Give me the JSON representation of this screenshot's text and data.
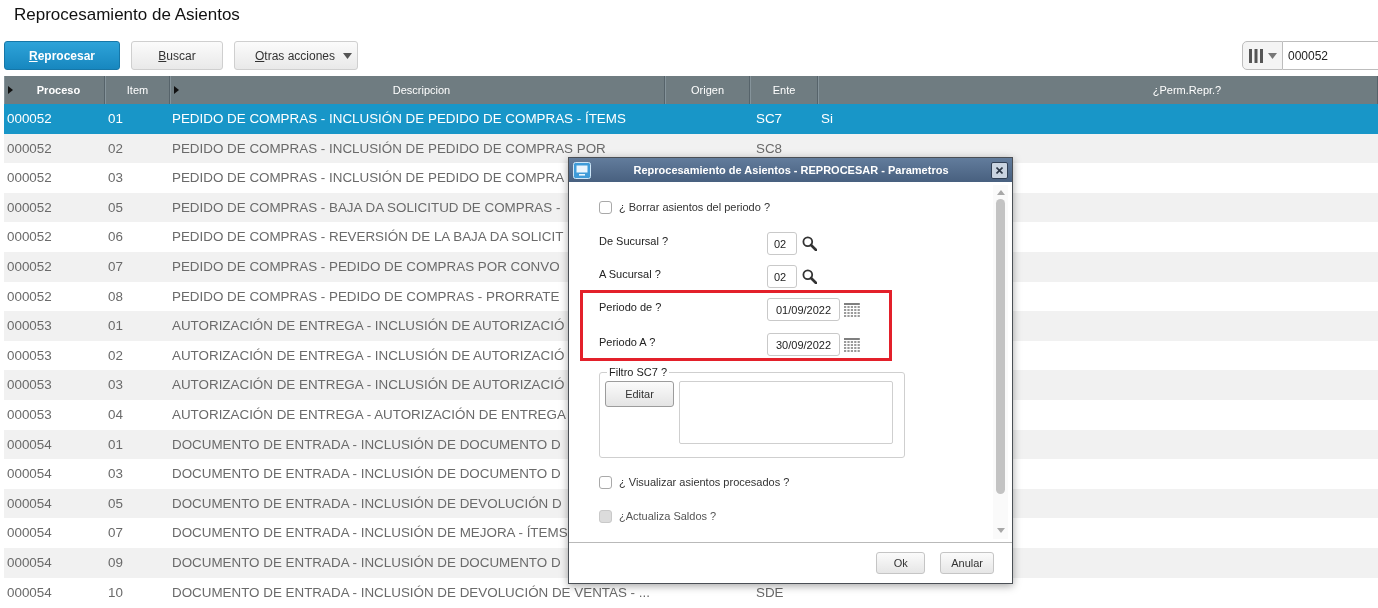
{
  "page": {
    "title": "Reprocesamiento de Asientos"
  },
  "toolbar": {
    "buttons": [
      {
        "label": "Reprocesar",
        "kind": "primary"
      },
      {
        "label": "Buscar",
        "kind": "plain"
      },
      {
        "label": "Otras acciones",
        "kind": "menu"
      }
    ],
    "search": {
      "value": "000052"
    }
  },
  "table": {
    "columns": [
      {
        "label": "Proceso",
        "expander": true,
        "bold": true
      },
      {
        "label": "Item",
        "expander": false,
        "bold": false
      },
      {
        "label": "Descripcion",
        "expander": true,
        "bold": false
      },
      {
        "label": "Origen",
        "expander": false,
        "bold": false
      },
      {
        "label": "Ente",
        "expander": false,
        "bold": false
      },
      {
        "label": "¿Perm.Repr.?",
        "expander": false,
        "bold": false
      }
    ],
    "rows": [
      {
        "proceso": "000052",
        "item": "01",
        "descripcion": "PEDIDO DE COMPRAS - INCLUSIÓN DE PEDIDO DE COMPRAS - ÍTEMS",
        "ente": "SC7",
        "perm_repr": "Si",
        "selected": true
      },
      {
        "proceso": "000052",
        "item": "02",
        "descripcion": "PEDIDO DE COMPRAS - INCLUSIÓN DE PEDIDO DE COMPRAS POR",
        "ente": "SC8",
        "selected": false
      },
      {
        "proceso": "000052",
        "item": "03",
        "descripcion": "PEDIDO DE COMPRAS - INCLUSIÓN DE PEDIDO DE COMPRA",
        "selected": false
      },
      {
        "proceso": "000052",
        "item": "05",
        "descripcion": "PEDIDO DE COMPRAS - BAJA DA SOLICITUD DE COMPRAS -",
        "selected": false
      },
      {
        "proceso": "000052",
        "item": "06",
        "descripcion": "PEDIDO DE COMPRAS - REVERSIÓN DE LA BAJA DA SOLICIT",
        "selected": false
      },
      {
        "proceso": "000052",
        "item": "07",
        "descripcion": "PEDIDO DE COMPRAS - PEDIDO DE COMPRAS POR CONVO",
        "selected": false
      },
      {
        "proceso": "000052",
        "item": "08",
        "descripcion": "PEDIDO DE COMPRAS - PEDIDO DE COMPRAS - PRORRATE",
        "selected": false
      },
      {
        "proceso": "000053",
        "item": "01",
        "descripcion": "AUTORIZACIÓN DE ENTREGA - INCLUSIÓN DE AUTORIZACIÓ",
        "selected": false
      },
      {
        "proceso": "000053",
        "item": "02",
        "descripcion": "AUTORIZACIÓN DE ENTREGA - INCLUSIÓN DE AUTORIZACIÓ",
        "selected": false
      },
      {
        "proceso": "000053",
        "item": "03",
        "descripcion": "AUTORIZACIÓN DE ENTREGA - INCLUSIÓN DE AUTORIZACIÓ",
        "selected": false
      },
      {
        "proceso": "000053",
        "item": "04",
        "descripcion": "AUTORIZACIÓN DE ENTREGA - AUTORIZACIÓN DE ENTREGA",
        "selected": false
      },
      {
        "proceso": "000054",
        "item": "01",
        "descripcion": "DOCUMENTO DE ENTRADA - INCLUSIÓN DE DOCUMENTO D",
        "selected": false
      },
      {
        "proceso": "000054",
        "item": "03",
        "descripcion": "DOCUMENTO DE ENTRADA - INCLUSIÓN DE DOCUMENTO D",
        "selected": false
      },
      {
        "proceso": "000054",
        "item": "05",
        "descripcion": "DOCUMENTO DE ENTRADA - INCLUSIÓN DE DEVOLUCIÓN D",
        "selected": false
      },
      {
        "proceso": "000054",
        "item": "07",
        "descripcion": "DOCUMENTO DE ENTRADA - INCLUSIÓN DE MEJORA - ÍTEMS",
        "selected": false
      },
      {
        "proceso": "000054",
        "item": "09",
        "descripcion": "DOCUMENTO DE ENTRADA - INCLUSIÓN DE DOCUMENTO D",
        "selected": false
      },
      {
        "proceso": "000054",
        "item": "10",
        "descripcion": "DOCUMENTO DE ENTRADA - INCLUSIÓN DE DEVOLUCIÓN DE VENTAS - ...",
        "ente": "SDE",
        "selected": false
      }
    ]
  },
  "dialog": {
    "title": "Reprocesamiento de Asientos - REPROCESAR - Parametros",
    "fields": [
      {
        "kind": "checkbox",
        "label": "¿ Borrar asientos del periodo ?",
        "checked": false,
        "disabled": false
      },
      {
        "kind": "lookup",
        "label": "De Sucursal ?",
        "value": "02"
      },
      {
        "kind": "lookup",
        "label": "A Sucursal ?",
        "value": "02"
      },
      {
        "kind": "group",
        "highlighted": true,
        "children": [
          {
            "kind": "date",
            "label": "Periodo de ?",
            "value": "01/09/2022"
          },
          {
            "kind": "date",
            "label": "Periodo A ?",
            "value": "30/09/2022"
          }
        ]
      },
      {
        "kind": "filter",
        "legend": "Filtro SC7 ?",
        "button": "Editar"
      },
      {
        "kind": "checkbox",
        "label": "¿ Visualizar asientos procesados ?",
        "checked": false,
        "disabled": false
      },
      {
        "kind": "checkbox",
        "label": "¿Actualiza Saldos ?",
        "checked": false,
        "disabled": true
      }
    ],
    "buttons": [
      "Ok",
      "Anular"
    ]
  }
}
